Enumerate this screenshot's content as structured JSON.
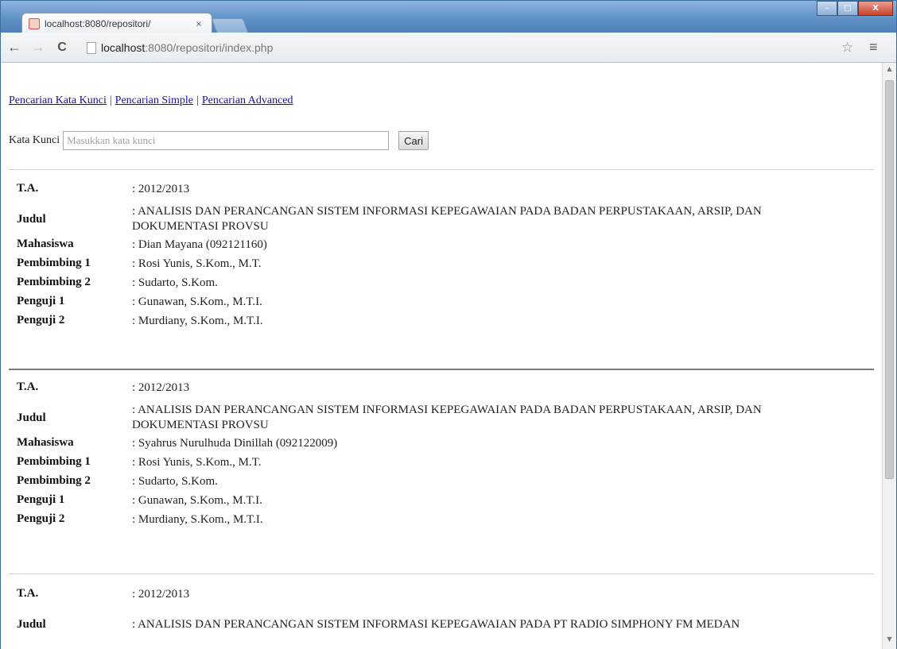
{
  "browser": {
    "tab_title": "localhost:8080/repositori/",
    "tab_close": "×",
    "url_host": "localhost",
    "url_path": ":8080/repositori/index.php",
    "back_icon": "←",
    "forward_icon": "→",
    "reload_icon": "C",
    "star_icon": "☆",
    "menu_icon": "≡",
    "window_controls": {
      "minimize": "–",
      "maximize": "□",
      "close": "X"
    }
  },
  "nav": {
    "links": [
      "Pencarian Kata Kunci",
      "Pencarian Simple",
      "Pencarian Advanced"
    ],
    "separator": "|"
  },
  "search": {
    "label": "Kata Kunci",
    "placeholder": "Masukkan kata kunci",
    "button": "Cari"
  },
  "labels": {
    "ta": "T.A.",
    "judul": "Judul",
    "mahasiswa": "Mahasiswa",
    "pembimbing1": "Pembimbing 1",
    "pembimbing2": "Pembimbing 2",
    "penguji1": "Penguji 1",
    "penguji2": "Penguji 2"
  },
  "records": [
    {
      "ta": ": 2012/2013",
      "judul": ": ANALISIS DAN PERANCANGAN SISTEM INFORMASI KEPEGAWAIAN PADA BADAN PERPUSTAKAAN, ARSIP, DAN DOKUMENTASI PROVSU",
      "mahasiswa": ": Dian Mayana (092121160)",
      "pembimbing1": ": Rosi Yunis, S.Kom., M.T.",
      "pembimbing2": ": Sudarto, S.Kom.",
      "penguji1": ": Gunawan, S.Kom., M.T.I.",
      "penguji2": ": Murdiany, S.Kom., M.T.I."
    },
    {
      "ta": ": 2012/2013",
      "judul": ": ANALISIS DAN PERANCANGAN SISTEM INFORMASI KEPEGAWAIAN PADA BADAN PERPUSTAKAAN, ARSIP, DAN DOKUMENTASI PROVSU",
      "mahasiswa": ": Syahrus Nurulhuda Dinillah (092122009)",
      "pembimbing1": ": Rosi Yunis, S.Kom., M.T.",
      "pembimbing2": ": Sudarto, S.Kom.",
      "penguji1": ": Gunawan, S.Kom., M.T.I.",
      "penguji2": ": Murdiany, S.Kom., M.T.I."
    },
    {
      "ta": ": 2012/2013",
      "judul": ": ANALISIS DAN PERANCANGAN SISTEM INFORMASI KEPEGAWAIAN PADA PT RADIO SIMPHONY FM MEDAN"
    }
  ]
}
